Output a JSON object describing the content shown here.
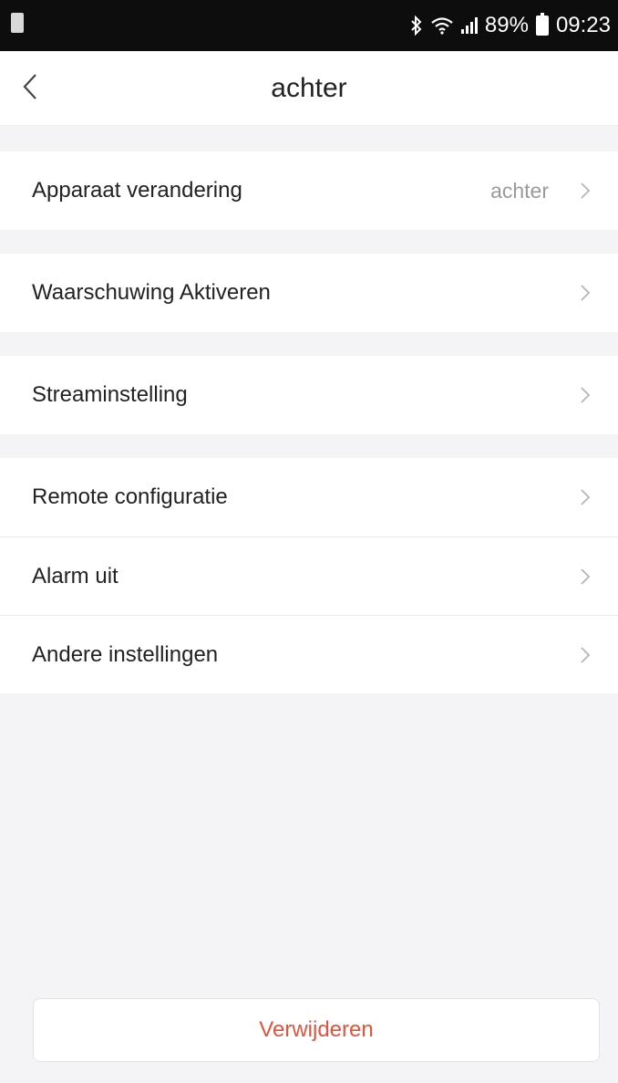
{
  "status_bar": {
    "battery_percent": "89%",
    "time": "09:23",
    "icons": [
      "sd-card-icon",
      "bluetooth-icon",
      "wifi-icon",
      "signal-icon",
      "battery-icon"
    ]
  },
  "header": {
    "title": "achter",
    "back_icon": "chevron-left-icon"
  },
  "settings": {
    "device_change": {
      "label": "Apparaat verandering",
      "value": "achter"
    },
    "alert_activate": {
      "label": "Waarschuwing Aktiveren"
    },
    "stream_setting": {
      "label": "Streaminstelling"
    },
    "remote_config": {
      "label": "Remote configuratie"
    },
    "alarm_off": {
      "label": "Alarm uit"
    },
    "other_settings": {
      "label": "Andere instellingen"
    }
  },
  "footer": {
    "delete_label": "Verwijderen"
  },
  "colors": {
    "status_bar": "#0d0d0d",
    "background": "#f4f4f6",
    "danger_text": "#e0533c",
    "secondary_text": "#9a9a9a"
  }
}
